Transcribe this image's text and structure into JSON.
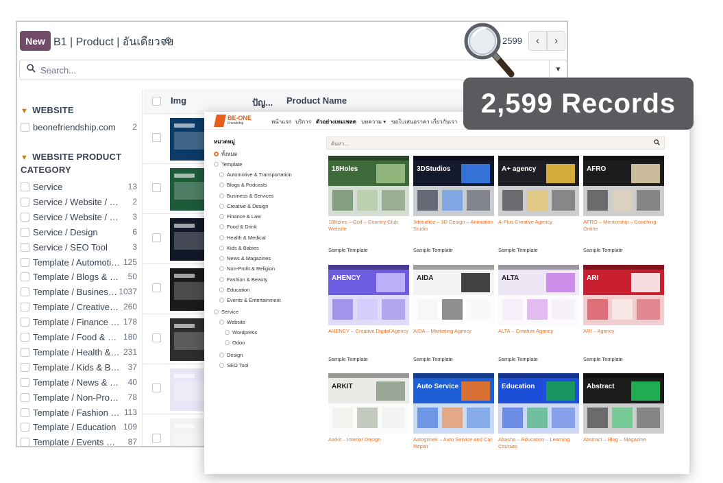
{
  "odoo": {
    "new_label": "New",
    "breadcrumb": "B1 | Product | อันเดียวจบ",
    "pager_value": "2599",
    "search_placeholder": "Search...",
    "sidebar": {
      "section1_title": "WEBSITE",
      "section1_items": [
        {
          "label": "beonefriendship.com",
          "count": "2"
        }
      ],
      "section2_title": "WEBSITE PRODUCT CATEGORY",
      "section2_items": [
        {
          "label": "Service",
          "count": "13"
        },
        {
          "label": "Service / Website / Wordpress",
          "count": "2"
        },
        {
          "label": "Service / Website / Odoo",
          "count": "3"
        },
        {
          "label": "Service / Design",
          "count": "6"
        },
        {
          "label": "Service / SEO Tool",
          "count": "3"
        },
        {
          "label": "Template / Automotive & Transportation",
          "count": "125"
        },
        {
          "label": "Template / Blogs & Podcasts",
          "count": "50"
        },
        {
          "label": "Template / Business & Services",
          "count": "1037"
        },
        {
          "label": "Template / Creative & Design",
          "count": "260"
        },
        {
          "label": "Template / Finance & Law",
          "count": "178"
        },
        {
          "label": "Template / Food & Drink",
          "count": "180"
        },
        {
          "label": "Template / Health & Medical",
          "count": "231"
        },
        {
          "label": "Template / Kids & Babies",
          "count": "37"
        },
        {
          "label": "Template / News & Magazines",
          "count": "40"
        },
        {
          "label": "Template / Non-Profit & Religion",
          "count": "78"
        },
        {
          "label": "Template / Fashion & Beauty",
          "count": "113"
        },
        {
          "label": "Template / Education",
          "count": "109"
        },
        {
          "label": "Template / Events & Entertainment",
          "count": "87"
        }
      ]
    },
    "list": {
      "col_img": "Img",
      "col_short": "ปัญ...",
      "col_name": "Product Name"
    }
  },
  "badge": {
    "text": "2,599 Records"
  },
  "web": {
    "logo_text": "BE-ONE",
    "logo_sub": "Friendship",
    "nav": [
      "หน้าแรก",
      "บริการ",
      "ตัวอย่างเทมเพลต",
      "บทความ ▾",
      "ขอใบเสนอราคา",
      "เกี่ยวกับเรา"
    ],
    "category_title": "หมวดหมู่",
    "categories": [
      {
        "label": "ทั้งหมด",
        "level": 0,
        "selected": true
      },
      {
        "label": "Template",
        "level": 0
      },
      {
        "label": "Automotive & Transportation",
        "level": 1
      },
      {
        "label": "Blogs & Podcasts",
        "level": 1
      },
      {
        "label": "Business & Services",
        "level": 1
      },
      {
        "label": "Creative & Design",
        "level": 1
      },
      {
        "label": "Finance & Law",
        "level": 1
      },
      {
        "label": "Food & Drink",
        "level": 1
      },
      {
        "label": "Health & Medical",
        "level": 1
      },
      {
        "label": "Kids & Babies",
        "level": 1
      },
      {
        "label": "News & Magazines",
        "level": 1
      },
      {
        "label": "Non-Profit & Religion",
        "level": 1
      },
      {
        "label": "Fashion & Beauty",
        "level": 1
      },
      {
        "label": "Education",
        "level": 1
      },
      {
        "label": "Events & Entertainment",
        "level": 1
      },
      {
        "label": "Service",
        "level": 0
      },
      {
        "label": "Website",
        "level": 1
      },
      {
        "label": "Wordpress",
        "level": 2
      },
      {
        "label": "Odoo",
        "level": 2
      },
      {
        "label": "Design",
        "level": 1
      },
      {
        "label": "SEO Tool",
        "level": 1
      }
    ],
    "search_placeholder": "ค้นหา...",
    "cards": [
      {
        "title": "18Holes – Golf – Country Club Website",
        "sample": "Sample Template",
        "bg": "#3f6b3a",
        "accent": "#9fc28a",
        "label": "18Holes"
      },
      {
        "title": "3dstudioz – 3D Design – Animation Studio",
        "sample": "Sample Template",
        "bg": "#141a2b",
        "accent": "#3b82f6",
        "label": "3DStudios"
      },
      {
        "title": "A-Plus Creative Agency",
        "sample": "Sample Template",
        "bg": "#1e1f24",
        "accent": "#f5c542",
        "label": "A+ agency"
      },
      {
        "title": "AFRO – Mentorship – Coaching Online",
        "sample": "Sample Template",
        "bg": "#1c1c1c",
        "accent": "#e8d6b0",
        "label": "AFRO"
      },
      {
        "title": "AHENCY – Creative Digital Agency",
        "sample": "Sample Template",
        "bg": "#6d5be0",
        "accent": "#c9c1ff",
        "label": "AHENCY"
      },
      {
        "title": "AIDA – Marketing Agency",
        "sample": "Sample Template",
        "bg": "#f3f3f5",
        "accent": "#222222",
        "label": "AIDA"
      },
      {
        "title": "ALTA – Creative Agency",
        "sample": "Sample Template",
        "bg": "#efe6f5",
        "accent": "#c77ee6",
        "label": "ALTA"
      },
      {
        "title": "ARI – Agency",
        "sample": "Sample Template",
        "bg": "#c9202f",
        "accent": "#ffffff",
        "label": "ARI"
      },
      {
        "title": "Aarkit – Interior Design",
        "sample": "",
        "bg": "#e9ece6",
        "accent": "#8a9a86",
        "label": "ARKIT"
      },
      {
        "title": "Aatogrinek – Auto Service and Car Repair",
        "sample": "",
        "bg": "#1f5fd6",
        "accent": "#f97316",
        "label": "Auto Service"
      },
      {
        "title": "Abasha – Education – Learning Courses",
        "sample": "",
        "bg": "#1d4ed8",
        "accent": "#16a34a",
        "label": "Education"
      },
      {
        "title": "Abstract – Blog – Magazine",
        "sample": "",
        "bg": "#1b1b1b",
        "accent": "#22c55e",
        "label": "Abstract"
      }
    ]
  }
}
